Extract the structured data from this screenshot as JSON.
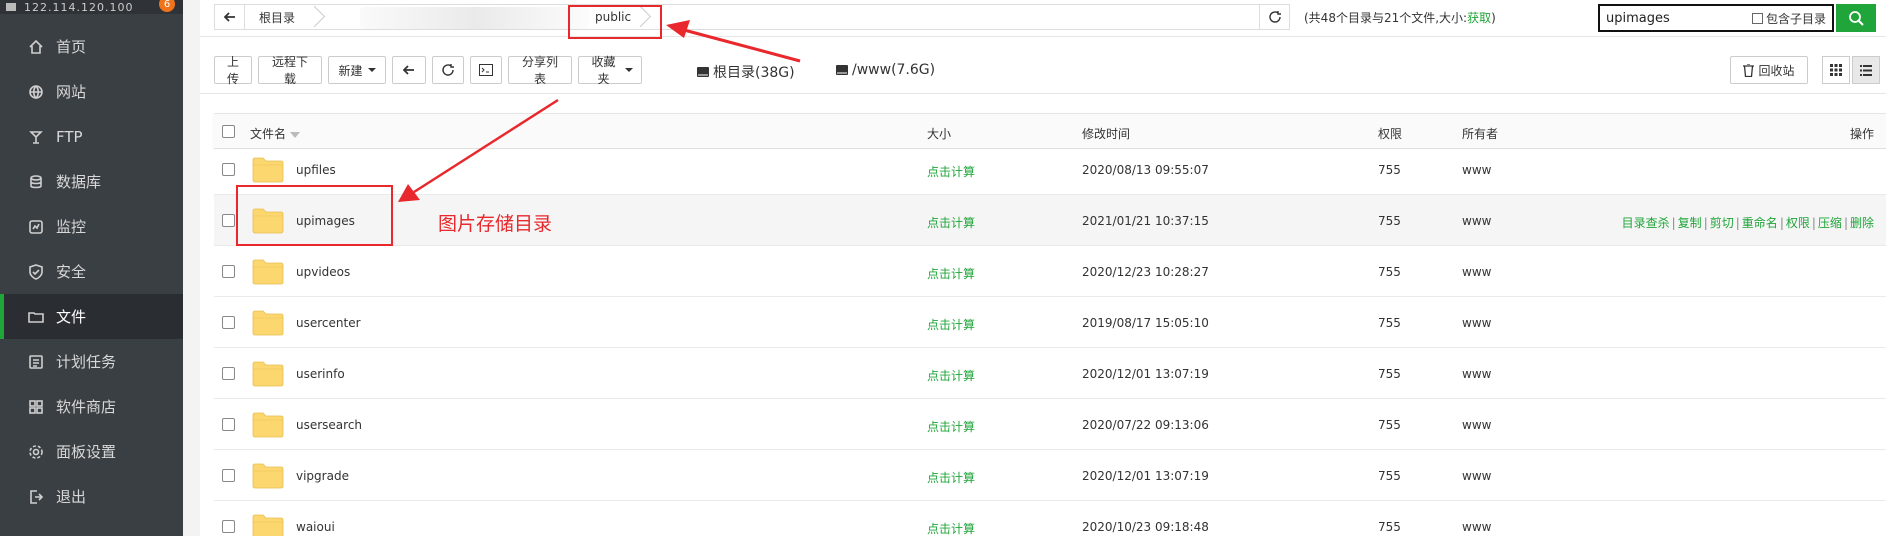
{
  "sidebar": {
    "server_ip": "122.114.120.100",
    "badge": "6",
    "items": [
      {
        "label": "首页",
        "icon": "home-icon"
      },
      {
        "label": "网站",
        "icon": "globe-icon"
      },
      {
        "label": "FTP",
        "icon": "ftp-icon"
      },
      {
        "label": "数据库",
        "icon": "database-icon"
      },
      {
        "label": "监控",
        "icon": "monitor-icon"
      },
      {
        "label": "安全",
        "icon": "shield-icon"
      },
      {
        "label": "文件",
        "icon": "folder-icon",
        "active": true
      },
      {
        "label": "计划任务",
        "icon": "clock-icon"
      },
      {
        "label": "软件商店",
        "icon": "apps-icon"
      },
      {
        "label": "面板设置",
        "icon": "gear-icon"
      },
      {
        "label": "退出",
        "icon": "logout-icon"
      }
    ]
  },
  "path_bar": {
    "crumb_root": "根目录",
    "crumb_current": "public",
    "stats_prefix": "(共48个目录与21个文件,大小:",
    "stats_link": "获取",
    "stats_suffix": ")"
  },
  "search": {
    "value": "upimages",
    "include_subdir_label": "包含子目录"
  },
  "toolbar": {
    "upload": "上传",
    "remote_download": "远程下载",
    "new": "新建",
    "share_list": "分享列表",
    "favorites": "收藏夹",
    "disk_root": "根目录(38G)",
    "disk_www": "/www(7.6G)",
    "recycle_bin": "回收站"
  },
  "table": {
    "headers": {
      "name": "文件名",
      "size": "大小",
      "mtime": "修改时间",
      "perm": "权限",
      "owner": "所有者",
      "ops": "操作"
    },
    "rows": [
      {
        "name": "upfiles",
        "size": "点击计算",
        "mtime": "2020/08/13 09:55:07",
        "perm": "755",
        "owner": "www"
      },
      {
        "name": "upimages",
        "size": "点击计算",
        "mtime": "2021/01/21 10:37:15",
        "perm": "755",
        "owner": "www",
        "highlight": true
      },
      {
        "name": "upvideos",
        "size": "点击计算",
        "mtime": "2020/12/23 10:28:27",
        "perm": "755",
        "owner": "www"
      },
      {
        "name": "usercenter",
        "size": "点击计算",
        "mtime": "2019/08/17 15:05:10",
        "perm": "755",
        "owner": "www"
      },
      {
        "name": "userinfo",
        "size": "点击计算",
        "mtime": "2020/12/01 13:07:19",
        "perm": "755",
        "owner": "www"
      },
      {
        "name": "usersearch",
        "size": "点击计算",
        "mtime": "2020/07/22 09:13:06",
        "perm": "755",
        "owner": "www"
      },
      {
        "name": "vipgrade",
        "size": "点击计算",
        "mtime": "2020/12/01 13:07:19",
        "perm": "755",
        "owner": "www"
      },
      {
        "name": "waioui",
        "size": "点击计算",
        "mtime": "2020/10/23 09:18:48",
        "perm": "755",
        "owner": "www"
      }
    ],
    "row_ops": [
      "目录查杀",
      "复制",
      "剪切",
      "重命名",
      "权限",
      "压缩",
      "删除"
    ]
  },
  "annotation": {
    "label": "图片存储目录",
    "color": "#e8282c"
  },
  "colors": {
    "accent": "#20a53a",
    "sidebar_bg": "#3a3f44",
    "folder": "#fcd770"
  }
}
